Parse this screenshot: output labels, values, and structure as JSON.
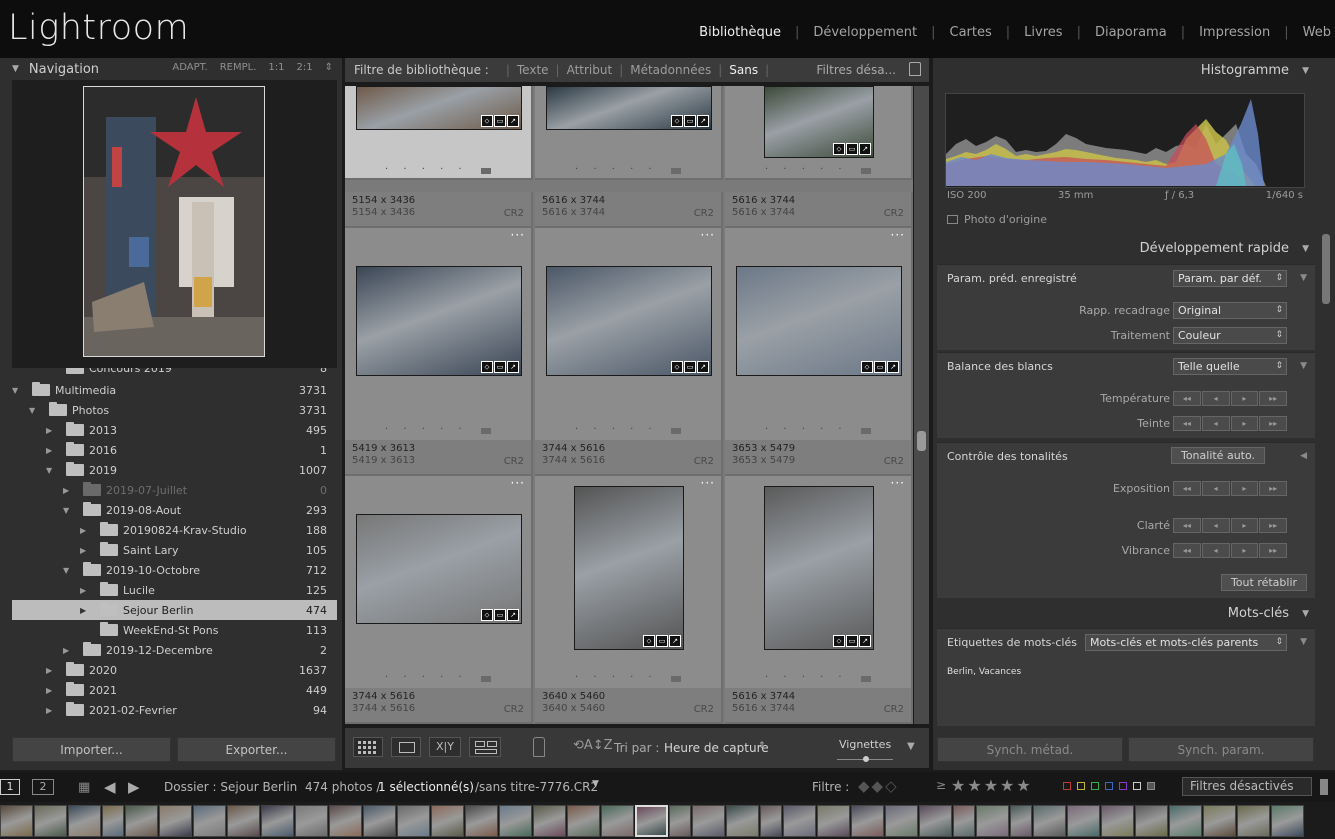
{
  "app": {
    "name": "Lightroom"
  },
  "modules": [
    "Bibliothèque",
    "Développement",
    "Cartes",
    "Livres",
    "Diaporama",
    "Impression",
    "Web"
  ],
  "active_module": "Bibliothèque",
  "navigator": {
    "title": "Navigation",
    "zoom_options": [
      "ADAPT.",
      "REMPL.",
      "1:1",
      "2:1"
    ]
  },
  "folders": [
    {
      "name": "Concours 2019",
      "count": "8",
      "depth": 2,
      "disclosure": "none",
      "state": "normal"
    },
    {
      "name": "Multimedia",
      "count": "3731",
      "depth": 0,
      "disclosure": "open",
      "state": "normal"
    },
    {
      "name": "Photos",
      "count": "3731",
      "depth": 1,
      "disclosure": "open",
      "state": "normal"
    },
    {
      "name": "2013",
      "count": "495",
      "depth": 2,
      "disclosure": "closed",
      "state": "normal"
    },
    {
      "name": "2016",
      "count": "1",
      "depth": 2,
      "disclosure": "closed",
      "state": "normal"
    },
    {
      "name": "2019",
      "count": "1007",
      "depth": 2,
      "disclosure": "open",
      "state": "normal"
    },
    {
      "name": "2019-07-Juillet",
      "count": "0",
      "depth": 3,
      "disclosure": "closed",
      "state": "dim"
    },
    {
      "name": "2019-08-Aout",
      "count": "293",
      "depth": 3,
      "disclosure": "open",
      "state": "normal"
    },
    {
      "name": "20190824-Krav-Studio",
      "count": "188",
      "depth": 4,
      "disclosure": "closed",
      "state": "normal"
    },
    {
      "name": "Saint Lary",
      "count": "105",
      "depth": 4,
      "disclosure": "closed",
      "state": "normal"
    },
    {
      "name": "2019-10-Octobre",
      "count": "712",
      "depth": 3,
      "disclosure": "open",
      "state": "normal"
    },
    {
      "name": "Lucile",
      "count": "125",
      "depth": 4,
      "disclosure": "closed",
      "state": "normal"
    },
    {
      "name": "Sejour Berlin",
      "count": "474",
      "depth": 4,
      "disclosure": "closed",
      "state": "selected"
    },
    {
      "name": "WeekEnd-St Pons",
      "count": "113",
      "depth": 4,
      "disclosure": "none",
      "state": "normal"
    },
    {
      "name": "2019-12-Decembre",
      "count": "2",
      "depth": 3,
      "disclosure": "closed",
      "state": "normal"
    },
    {
      "name": "2020",
      "count": "1637",
      "depth": 2,
      "disclosure": "closed",
      "state": "normal"
    },
    {
      "name": "2021",
      "count": "449",
      "depth": 2,
      "disclosure": "closed",
      "state": "normal"
    },
    {
      "name": "2021-02-Fevrier",
      "count": "94",
      "depth": 2,
      "disclosure": "closed",
      "state": "normal"
    }
  ],
  "left_buttons": {
    "import": "Importer...",
    "export": "Exporter..."
  },
  "filter_bar": {
    "label": "Filtre de bibliothèque :",
    "tabs": [
      "Texte",
      "Attribut",
      "Métadonnées",
      "Sans"
    ],
    "active": "Sans",
    "preset": "Filtres désa..."
  },
  "grid_rows": [
    {
      "dims": [
        "5154 x 3436",
        "5616 x 3744",
        "5616 x 3744"
      ],
      "ext": "CR2"
    },
    {
      "dims": [
        "5419 x 3613",
        "3744 x 5616",
        "3653 x 5479"
      ],
      "ext": "CR2"
    },
    {
      "dims": [
        "3744 x 5616",
        "3640 x 5460",
        "5616 x 3744"
      ],
      "ext": "CR2"
    }
  ],
  "toolbar": {
    "sort_label": "Tri par :",
    "sort_value": "Heure de capture",
    "thumbs_label": "Vignettes"
  },
  "histogram": {
    "title": "Histogramme",
    "iso": "ISO 200",
    "focal": "35 mm",
    "aperture": "ƒ / 6,3",
    "shutter": "1/640 s",
    "original_label": "Photo d'origine"
  },
  "quick_develop": {
    "title": "Développement rapide",
    "preset_label": "Param. préd. enregistré",
    "preset_value": "Param. par déf.",
    "crop_label": "Rapp. recadrage",
    "crop_value": "Original",
    "treatment_label": "Traitement",
    "treatment_value": "Couleur",
    "wb_label": "Balance des blancs",
    "wb_value": "Telle quelle",
    "temp_label": "Température",
    "tint_label": "Teinte",
    "tone_label": "Contrôle des tonalités",
    "auto_tone": "Tonalité auto.",
    "exposure_label": "Exposition",
    "clarity_label": "Clarté",
    "vibrance_label": "Vibrance",
    "reset_all": "Tout rétablir"
  },
  "keywords": {
    "title": "Mots-clés",
    "tags_label": "Etiquettes de mots-clés",
    "tags_mode": "Mots-clés et mots-clés parents",
    "value": "Berlin, Vacances"
  },
  "right_buttons": {
    "sync_meta": "Synch. métad.",
    "sync_settings": "Synch. param."
  },
  "status": {
    "screen1": "1",
    "screen2": "2",
    "folder_text": "Dossier : Sejour Berlin",
    "photo_count": "474 photos /",
    "selected": "1 sélectionné(s)",
    "filename": "/sans titre-7776.CR2",
    "filter_label": "Filtre :",
    "filters_off": "Filtres désactivés"
  }
}
